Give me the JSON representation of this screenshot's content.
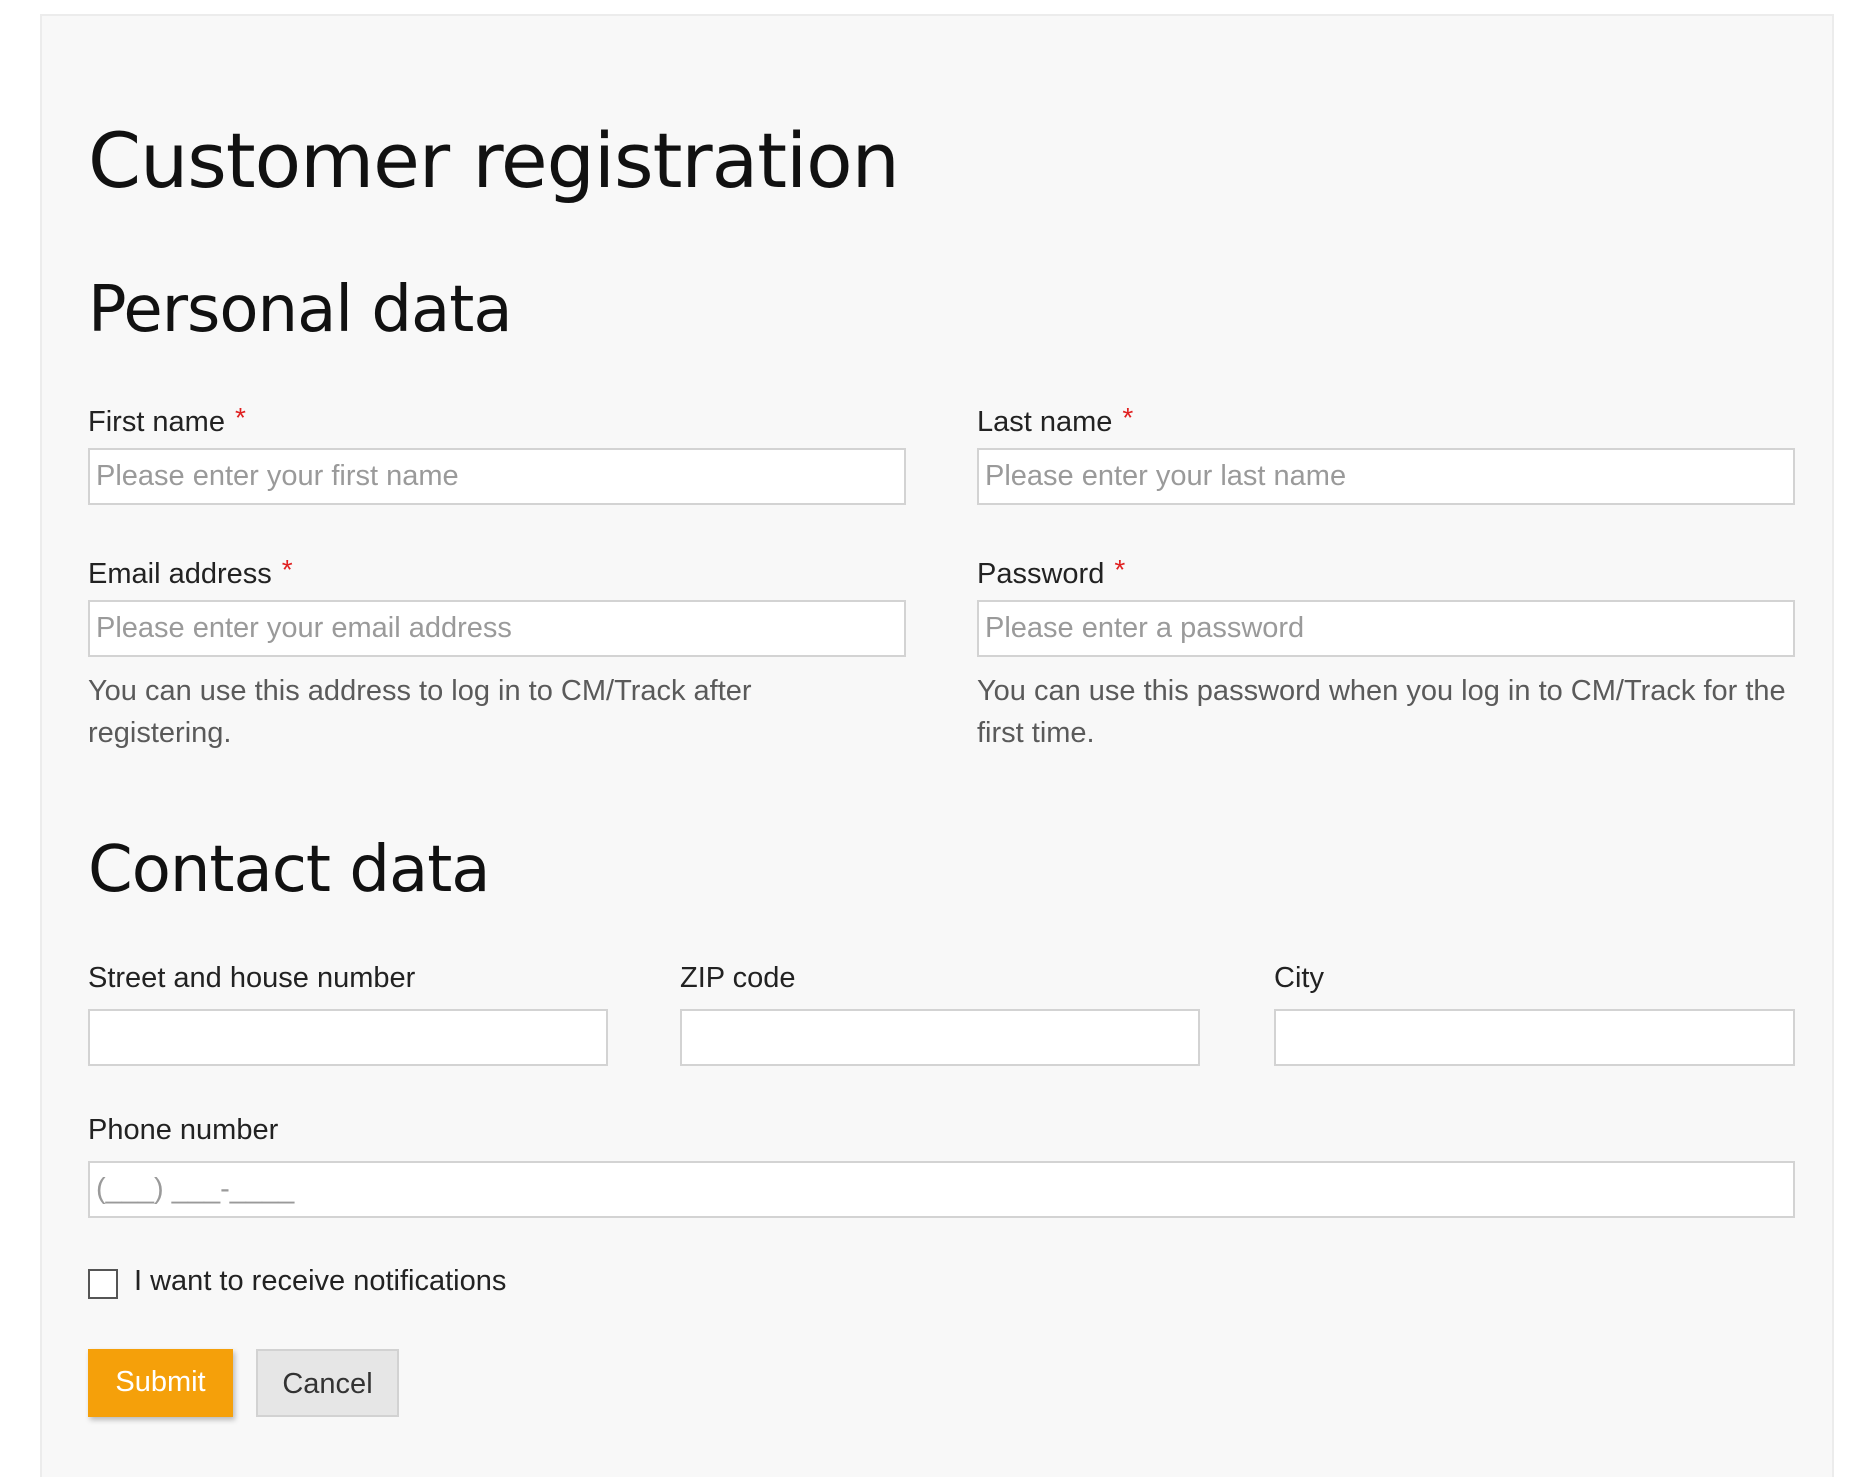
{
  "page": {
    "title": "Customer registration"
  },
  "personal": {
    "heading": "Personal data",
    "first_name": {
      "label": "First name",
      "required_mark": "*",
      "placeholder": "Please enter your first name",
      "value": ""
    },
    "last_name": {
      "label": "Last name",
      "required_mark": "*",
      "placeholder": "Please enter your last name",
      "value": ""
    },
    "email": {
      "label": "Email address",
      "required_mark": "*",
      "placeholder": "Please enter your email address",
      "value": "",
      "help": "You can use this address to log in to CM/Track after registering."
    },
    "password": {
      "label": "Password",
      "required_mark": "*",
      "placeholder": "Please enter a password",
      "value": "",
      "help": "You can use this password when you log in to CM/Track for the first time."
    }
  },
  "contact": {
    "heading": "Contact data",
    "street": {
      "label": "Street and house number",
      "value": ""
    },
    "zip": {
      "label": "ZIP code",
      "value": ""
    },
    "city": {
      "label": "City",
      "value": ""
    },
    "phone": {
      "label": "Phone number",
      "placeholder": "(___) ___-____",
      "value": ""
    }
  },
  "notifications": {
    "label": "I want to receive notifications",
    "checked": false
  },
  "actions": {
    "submit_label": "Submit",
    "cancel_label": "Cancel"
  },
  "colors": {
    "accent": "#f5a00a",
    "required": "#e02020",
    "panel_background": "#f8f8f8"
  }
}
